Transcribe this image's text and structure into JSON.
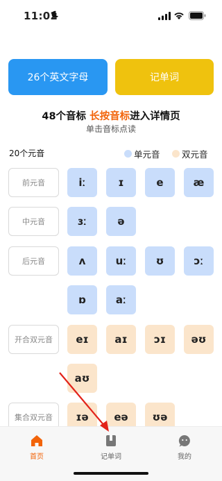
{
  "status_bar": {
    "time": "11:02"
  },
  "buttons": {
    "letters": "26个英文字母",
    "vocab": "记单词"
  },
  "headline": {
    "prefix": "48个音标 ",
    "highlight": "长按音标",
    "suffix": "进入详情页"
  },
  "subline": "单击音标点读",
  "vowel_count": "20个元音",
  "legend": {
    "mono": "单元音",
    "di": "双元音"
  },
  "categories": {
    "front": "前元音",
    "central": "中元音",
    "back": "后元音",
    "opening_diph": "开合双元音",
    "centering_diph": "集合双元音"
  },
  "phonemes": {
    "front": [
      "iː",
      "ɪ",
      "e",
      "æ"
    ],
    "central": [
      "ɜː",
      "ə"
    ],
    "back": [
      "ʌ",
      "uː",
      "ʊ",
      "ɔː",
      "ɒ",
      "aː"
    ],
    "opening": [
      "eɪ",
      "aɪ",
      "ɔɪ",
      "əʊ",
      "aʊ"
    ],
    "centering": [
      "ɪə",
      "eə",
      "ʊə"
    ]
  },
  "tabs": {
    "home": "首页",
    "vocab": "记单词",
    "mine": "我的"
  },
  "colors": {
    "accent": "#f2640a",
    "blue_button": "#2997f2",
    "yellow_button": "#efc20e",
    "mono": "#c9ddfb",
    "di": "#fbe5cb"
  }
}
